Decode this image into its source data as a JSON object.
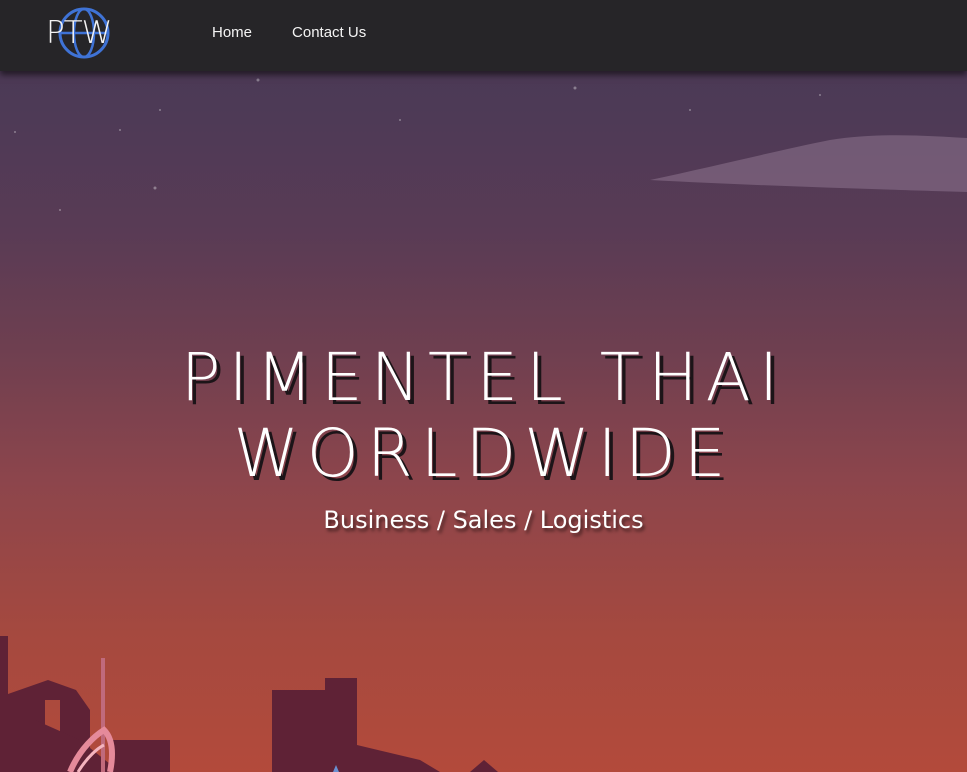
{
  "header": {
    "logo_text": "PTW",
    "nav": [
      {
        "label": "Home"
      },
      {
        "label": "Contact Us"
      }
    ]
  },
  "hero": {
    "title_line1": "PIMENTEL THAI",
    "title_line2": "WORLDWIDE",
    "subtitle": "Business / Sales / Logistics"
  },
  "colors": {
    "header_bg": "#262528",
    "logo_globe": "#3f73d6",
    "sky_top": "#4a3753",
    "sky_bottom": "#b34a3b",
    "skyline": "#5f2236"
  }
}
